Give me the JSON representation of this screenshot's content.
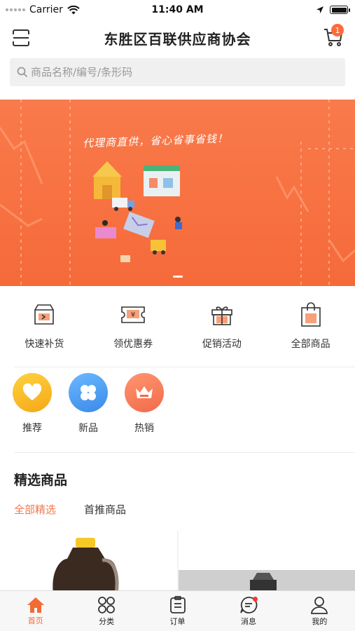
{
  "status": {
    "carrier": "Carrier",
    "time": "11:40 AM",
    "battery_level": 1.0
  },
  "header": {
    "title": "东胜区百联供应商协会",
    "cart_count": "1",
    "scan_icon": "scan-icon",
    "cart_icon": "cart-icon"
  },
  "search": {
    "placeholder": "商品名称/编号/条形码",
    "icon": "search-icon"
  },
  "banner": {
    "slogan": "代理商直供，省心省事省钱！",
    "slides": 1,
    "active_slide": 1
  },
  "quick_entries": [
    {
      "label": "快速补货",
      "icon": "restock-box-icon"
    },
    {
      "label": "领优惠券",
      "icon": "coupon-icon"
    },
    {
      "label": "促销活动",
      "icon": "gift-icon"
    },
    {
      "label": "全部商品",
      "icon": "shopping-bag-icon"
    }
  ],
  "categories": [
    {
      "label": "推荐",
      "icon": "heart-icon",
      "color": "#f7b818"
    },
    {
      "label": "新品",
      "icon": "clover-icon",
      "color": "#4a9ff0"
    },
    {
      "label": "热销",
      "icon": "crown-icon",
      "color": "#f47a5a"
    }
  ],
  "featured": {
    "title": "精选商品",
    "tabs": [
      {
        "label": "全部精选",
        "active": true
      },
      {
        "label": "首推商品",
        "active": false
      }
    ]
  },
  "tabbar": [
    {
      "label": "首页",
      "icon": "home-icon",
      "active": true
    },
    {
      "label": "分类",
      "icon": "category-icon",
      "active": false
    },
    {
      "label": "订单",
      "icon": "order-icon",
      "active": false
    },
    {
      "label": "消息",
      "icon": "message-icon",
      "active": false,
      "unread": true
    },
    {
      "label": "我的",
      "icon": "profile-icon",
      "active": false
    }
  ],
  "colors": {
    "accent": "#f36a34",
    "banner": "#f77645"
  }
}
